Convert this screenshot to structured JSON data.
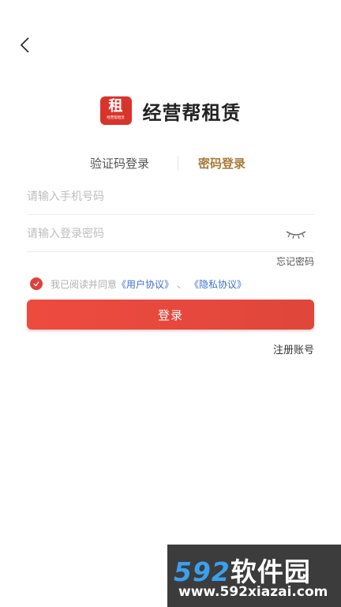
{
  "header": {
    "back_icon": "chevron-left-icon"
  },
  "brand": {
    "logo_char": "租",
    "logo_sub": "经营帮租赁",
    "title": "经营帮租赁",
    "color": "#d9342b"
  },
  "tabs": [
    {
      "label": "验证码登录",
      "active": false
    },
    {
      "label": "密码登录",
      "active": true
    }
  ],
  "form": {
    "phone_placeholder": "请输入手机号码",
    "password_placeholder": "请输入登录密码",
    "eye_icon": "eye-closed-icon",
    "forgot_label": "忘记密码"
  },
  "agreement": {
    "checked": true,
    "prefix": "我已阅读并同意",
    "user_agreement": "《用户协议》",
    "separator": "、",
    "privacy_policy": "《隐私协议》"
  },
  "login_button": "登录",
  "register_label": "注册账号",
  "watermark": {
    "num": "592",
    "cn": "软件园",
    "url": "www.592xiazai.com"
  },
  "colors": {
    "accent": "#e0463b",
    "tab_active": "#a77b3a",
    "link": "#3f6fcf"
  }
}
